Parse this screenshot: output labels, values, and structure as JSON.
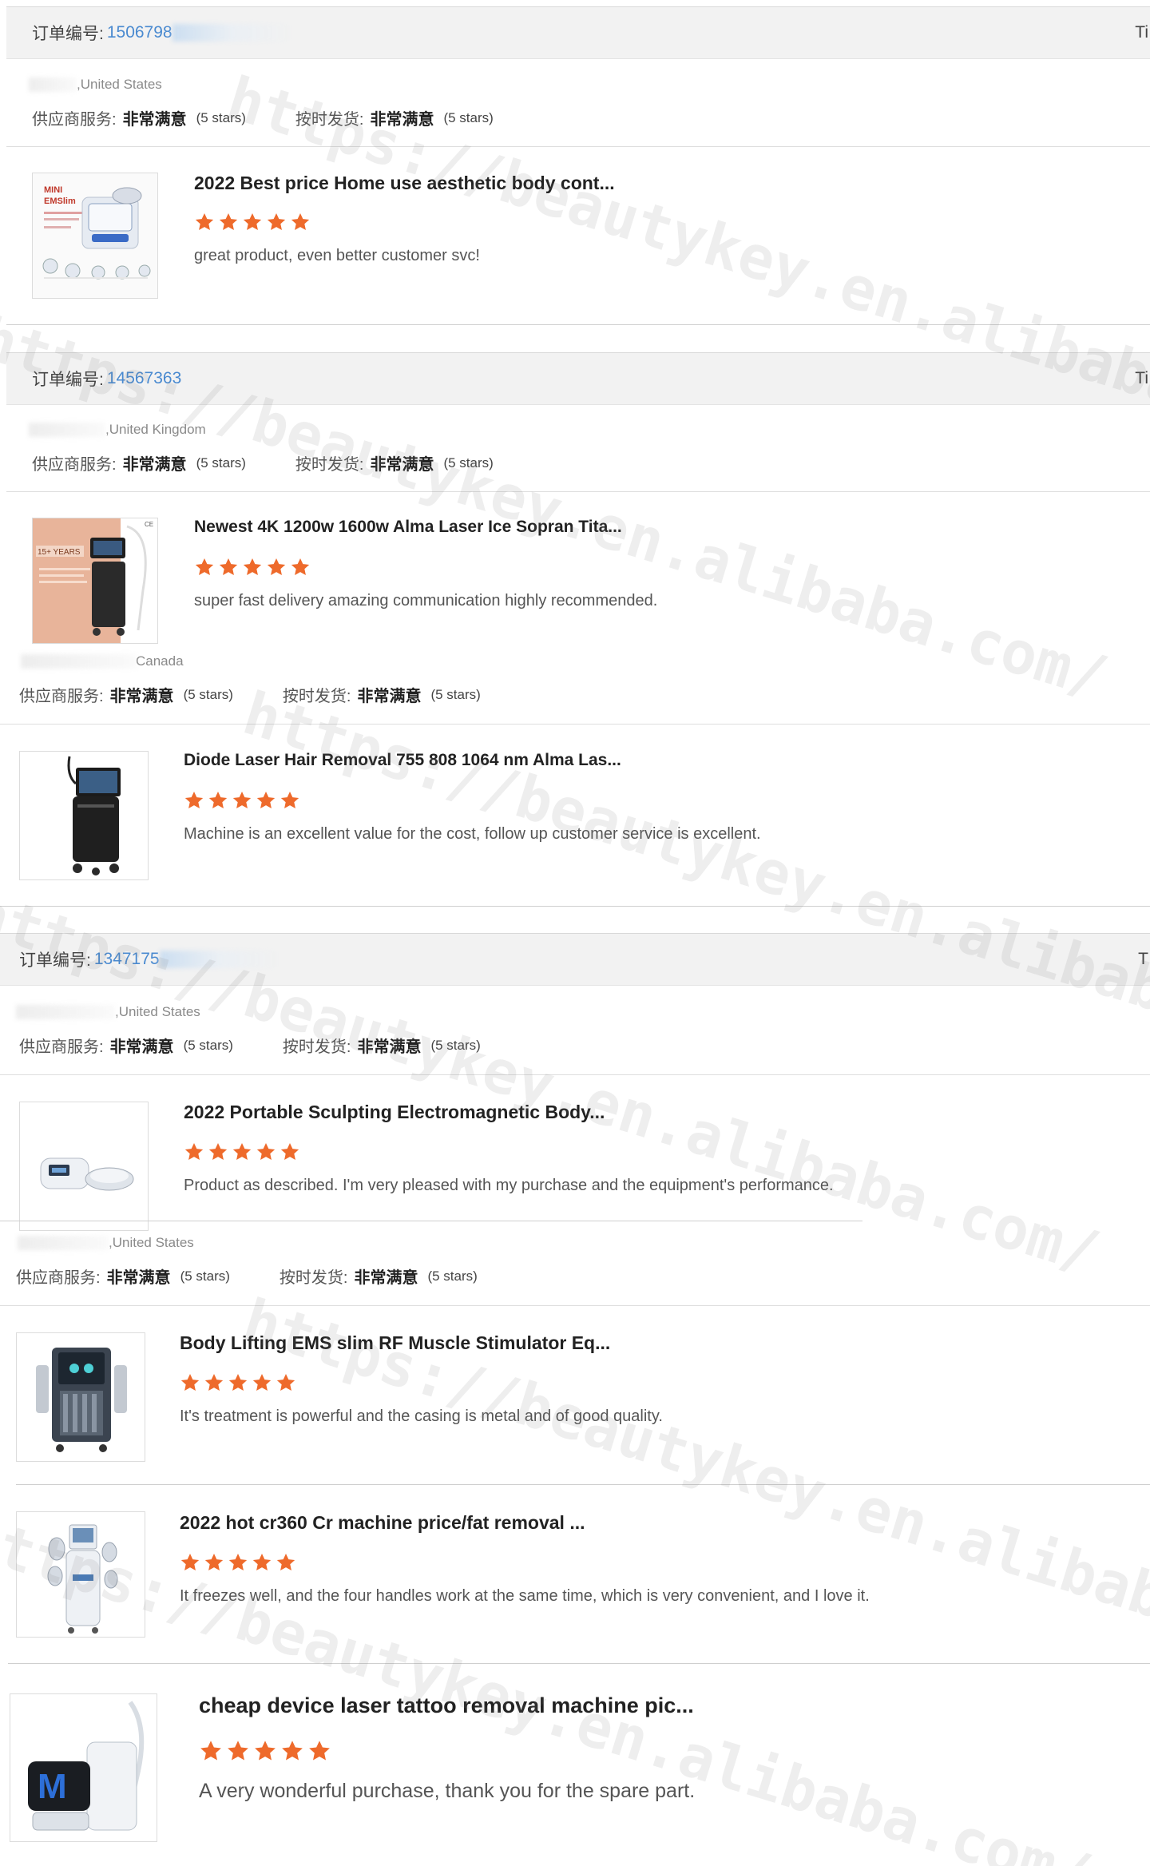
{
  "orders": [
    {
      "order_label": "订单编号:",
      "order_number": "1506798",
      "trail": "Ti",
      "reviews": [
        {
          "country": ",United States",
          "supplier_label": "供应商服务:",
          "supplier_value": "非常满意",
          "supplier_stars": "(5 stars)",
          "shipping_label": "按时发货:",
          "shipping_value": "非常满意",
          "shipping_stars": "(5 stars)",
          "product_title": "2022 Best price Home use aesthetic body cont...",
          "thumb_caption": "MINI EMSlim",
          "rating": 5,
          "comment": "great product, even better customer svc!"
        }
      ]
    },
    {
      "order_label": "订单编号:",
      "order_number": "14567363",
      "trail": "Ti",
      "reviews": [
        {
          "country": ",United Kingdom",
          "supplier_label": "供应商服务:",
          "supplier_value": "非常满意",
          "supplier_stars": "(5 stars)",
          "shipping_label": "按时发货:",
          "shipping_value": "非常满意",
          "shipping_stars": "(5 stars)",
          "product_title": "Newest 4K 1200w 1600w Alma Laser Ice Sopran Tita...",
          "thumb_caption": "15+ YEARS",
          "rating": 5,
          "comment": "super fast delivery amazing communication highly recommended."
        },
        {
          "country": "Canada",
          "supplier_label": "供应商服务:",
          "supplier_value": "非常满意",
          "supplier_stars": "(5 stars)",
          "shipping_label": "按时发货:",
          "shipping_value": "非常满意",
          "shipping_stars": "(5 stars)",
          "product_title": "Diode Laser Hair Removal 755 808 1064 nm Alma Las...",
          "rating": 5,
          "comment": "Machine is an excellent value for the cost, follow up customer service is excellent."
        }
      ]
    },
    {
      "order_label": "订单编号:",
      "order_number": "1347175",
      "trail": "T",
      "reviews": [
        {
          "country": ",United States",
          "supplier_label": "供应商服务:",
          "supplier_value": "非常满意",
          "supplier_stars": "(5 stars)",
          "shipping_label": "按时发货:",
          "shipping_value": "非常满意",
          "shipping_stars": "(5 stars)",
          "product_title": "2022 Portable Sculpting Electromagnetic Body...",
          "rating": 5,
          "comment": "Product as described. I'm very pleased with my purchase and the equipment's performance."
        },
        {
          "country": ",United States",
          "supplier_label": "供应商服务:",
          "supplier_value": "非常满意",
          "supplier_stars": "(5 stars)",
          "shipping_label": "按时发货:",
          "shipping_value": "非常满意",
          "shipping_stars": "(5 stars)",
          "product_title": "Body Lifting EMS slim RF Muscle Stimulator Eq...",
          "rating": 5,
          "comment": "It's treatment is powerful and the casing is metal and of good quality."
        },
        {
          "product_title": "2022 hot cr360 Cr machine price/fat removal ...",
          "rating": 5,
          "comment": "It freezes well, and the four handles work at the same time, which is very convenient, and I love it."
        },
        {
          "product_title": "cheap device laser tattoo removal machine pic...",
          "rating": 5,
          "comment": "A very wonderful purchase, thank you for the spare part."
        }
      ]
    }
  ],
  "watermark_text": "https://beautykey.en.alibaba.com/",
  "colors": {
    "star": "#ee6a2b",
    "order_number": "#4a8ad0",
    "header_bg": "#f2f2f2"
  }
}
